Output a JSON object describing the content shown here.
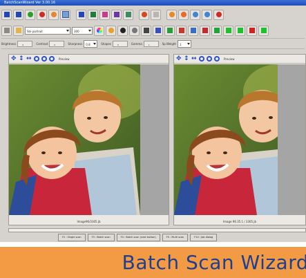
{
  "window": {
    "title": "BatchScanWizard  Ver 3.00.16"
  },
  "toolbar": {
    "row2": {
      "profile_select": "Ste portrait",
      "res_select": "300"
    },
    "adjust": [
      {
        "label": "Brightness",
        "value": "0"
      },
      {
        "label": "Contrast",
        "value": "0"
      },
      {
        "label": "Sharpness",
        "value": "0.8"
      },
      {
        "label": "Shapes",
        "value": "0"
      },
      {
        "label": "Gamma",
        "value": "1"
      },
      {
        "label": "Sp.Weight",
        "value": "1"
      }
    ]
  },
  "preview_left": {
    "tool_label": "Preview",
    "status": "Image96/3305.jb"
  },
  "preview_right": {
    "tool_label": "Preview",
    "status": "Image 96.35.1 / 3305.jb"
  },
  "function_keys": [
    "F2 : Single scan",
    "F3 : Batch scan",
    "F4 : Batch scan (next button)",
    "F5 : Multi scan",
    "F10 : Job dialog"
  ],
  "banner": {
    "title": "Batch Scan Wizard"
  },
  "colors": {
    "accent": "#1d3f8f",
    "banner_bg": "#f39a45",
    "titlebar": "#2a5cc8"
  }
}
